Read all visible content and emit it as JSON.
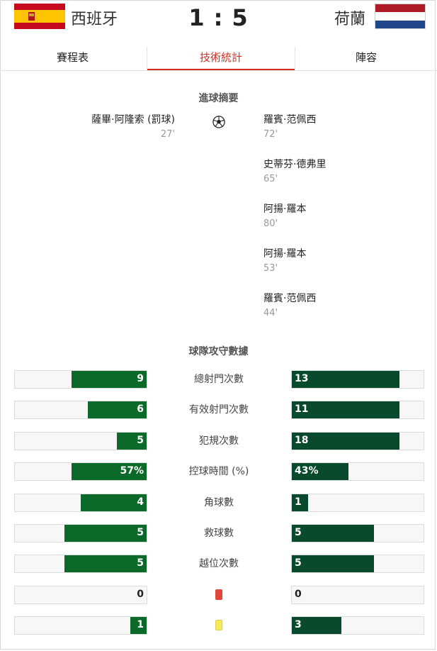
{
  "match": {
    "home_team": "西班牙",
    "away_team": "荷蘭",
    "home_score": "1",
    "separator": ":",
    "away_score": "5"
  },
  "tabs": [
    "賽程表",
    "技術統計",
    "陣容"
  ],
  "goals_section": {
    "title": "進球摘要",
    "home": [
      {
        "player": "薩畢·阿隆索 (罰球)",
        "minute": "27'"
      }
    ],
    "away": [
      {
        "player": "羅賓·范佩西",
        "minute": "72'"
      },
      {
        "player": "史蒂芬·德弗里",
        "minute": "65'"
      },
      {
        "player": "阿揚·羅本",
        "minute": "80'"
      },
      {
        "player": "阿揚·羅本",
        "minute": "53'"
      },
      {
        "player": "羅賓·范佩西",
        "minute": "44'"
      }
    ]
  },
  "stats_section": {
    "title": "球隊攻守數據",
    "rows": [
      {
        "label": "總射門次數",
        "home": "9",
        "away": "13",
        "home_num": 9,
        "away_num": 13
      },
      {
        "label": "有效射門次數",
        "home": "6",
        "away": "11",
        "home_num": 6,
        "away_num": 11
      },
      {
        "label": "犯規次數",
        "home": "5",
        "away": "18",
        "home_num": 5,
        "away_num": 18
      },
      {
        "label": "控球時間 (%)",
        "home": "57%",
        "away": "43%",
        "home_num": 57,
        "away_num": 43
      },
      {
        "label": "角球數",
        "home": "4",
        "away": "1",
        "home_num": 4,
        "away_num": 1
      },
      {
        "label": "救球數",
        "home": "5",
        "away": "5",
        "home_num": 5,
        "away_num": 5
      },
      {
        "label": "越位次數",
        "home": "5",
        "away": "5",
        "home_num": 5,
        "away_num": 5
      },
      {
        "label": "",
        "icon": "red-card-icon",
        "home": "0",
        "away": "0",
        "home_num": 0,
        "away_num": 0
      },
      {
        "label": "",
        "icon": "yellow-card-icon",
        "home": "1",
        "away": "3",
        "home_num": 1,
        "away_num": 3
      }
    ]
  },
  "colors": {
    "accent": "#d0301f",
    "home_bar": "#0b6a2a",
    "away_bar": "#0a4a2c",
    "red_card": "#e0463a",
    "yellow_card": "#f5ea5a"
  }
}
